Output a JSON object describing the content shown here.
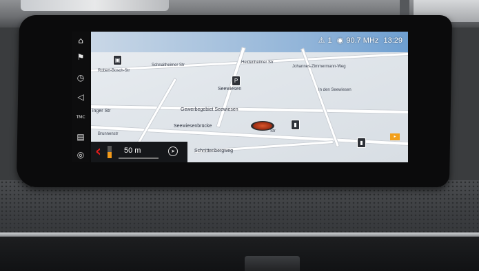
{
  "status_bar": {
    "warning_count": "1",
    "radio_frequency": "90.7 MHz",
    "clock": "13:29"
  },
  "side_menu": {
    "tmc_label": "TMC"
  },
  "map_labels": {
    "l1": "Robert-Bosch-Str",
    "l2": "Schnaitheimer Str",
    "l3": "Heidenheimer Str",
    "l4": "Johannes-Zimmermann-Weg",
    "l5": "Seewiesen",
    "l6": "In den Seewiesen",
    "l7": "Gewerbegebiet Seewiesen",
    "l8": "Seewiesenbrücke",
    "l9": "Schnittenbergweg",
    "l10": "Str",
    "l11": "inger Str",
    "l12": "Brunnenstr"
  },
  "guidance": {
    "distance": "50 m"
  },
  "colors": {
    "turn_arrow": "#e21b1b",
    "distance_bar": "#f29a1a",
    "car_marker": "#d8562c"
  }
}
